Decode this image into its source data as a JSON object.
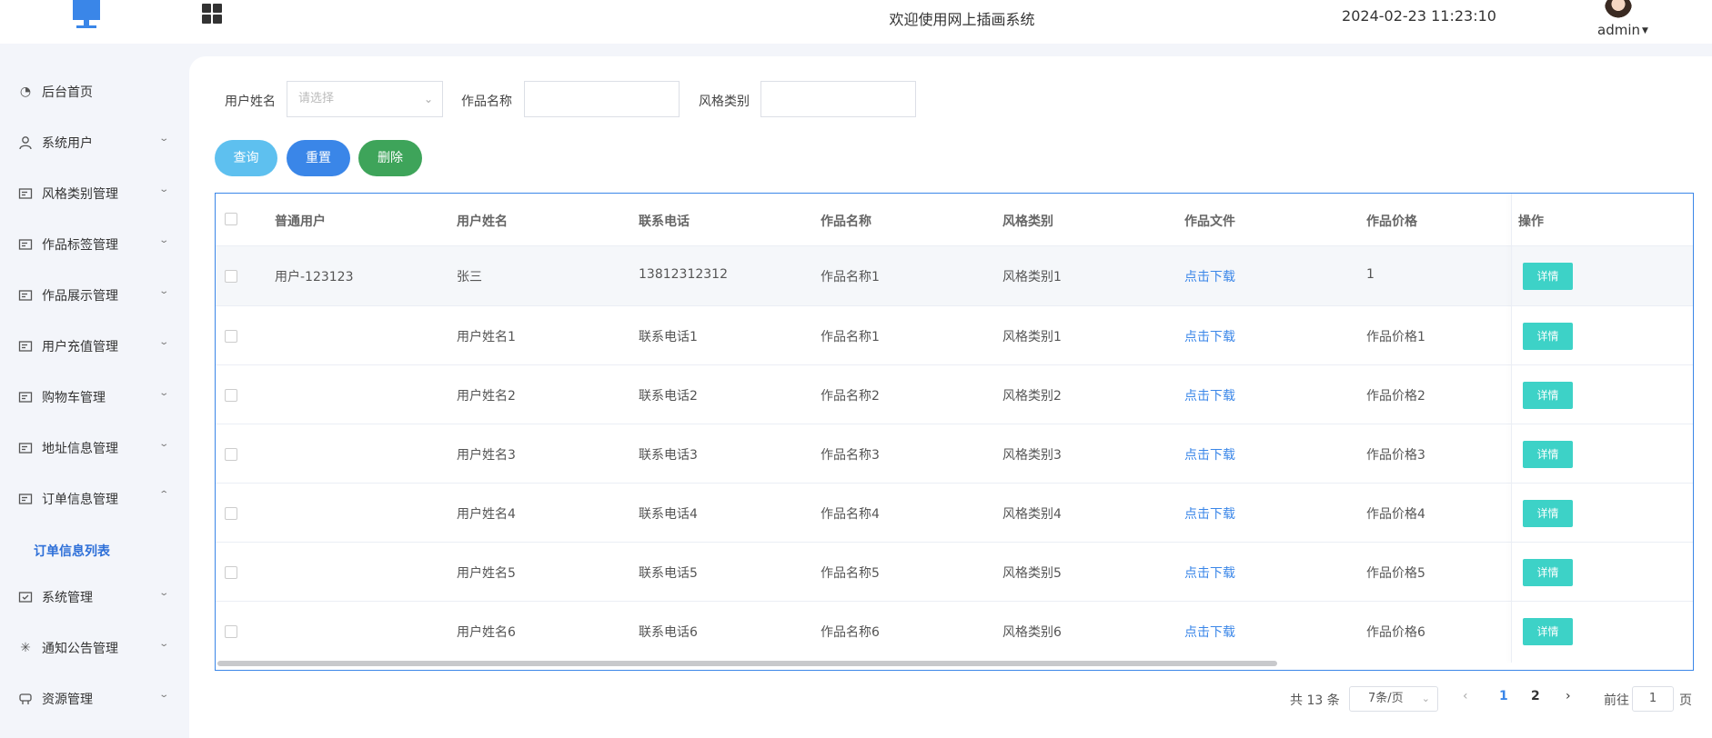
{
  "header": {
    "welcome": "欢迎使用网上插画系统",
    "datetime": "2024-02-23 11:23:10",
    "username": "admin"
  },
  "sidebar": {
    "items": [
      {
        "label": "后台首页",
        "icon": "dashboard-icon",
        "expanded": null
      },
      {
        "label": "系统用户",
        "icon": "user-icon",
        "expanded": false
      },
      {
        "label": "风格类别管理",
        "icon": "card-icon",
        "expanded": false
      },
      {
        "label": "作品标签管理",
        "icon": "card-icon",
        "expanded": false
      },
      {
        "label": "作品展示管理",
        "icon": "card-icon",
        "expanded": false
      },
      {
        "label": "用户充值管理",
        "icon": "card-icon",
        "expanded": false
      },
      {
        "label": "购物车管理",
        "icon": "card-icon",
        "expanded": false
      },
      {
        "label": "地址信息管理",
        "icon": "card-icon",
        "expanded": false
      },
      {
        "label": "订单信息管理",
        "icon": "card-icon",
        "expanded": true
      },
      {
        "label": "系统管理",
        "icon": "system-icon",
        "expanded": false
      },
      {
        "label": "通知公告管理",
        "icon": "notice-icon",
        "expanded": false
      },
      {
        "label": "资源管理",
        "icon": "resource-icon",
        "expanded": false
      }
    ],
    "active_sub": "订单信息列表"
  },
  "filters": {
    "user_name_label": "用户姓名",
    "user_name_placeholder": "请选择",
    "work_name_label": "作品名称",
    "work_name_value": "",
    "style_label": "风格类别",
    "style_value": ""
  },
  "buttons": {
    "query": "查询",
    "reset": "重置",
    "delete": "删除"
  },
  "table": {
    "columns": [
      "普通用户",
      "用户姓名",
      "联系电话",
      "作品名称",
      "风格类别",
      "作品文件",
      "作品价格",
      "操作"
    ],
    "download_label": "点击下载",
    "detail_label": "详情",
    "rows": [
      [
        "用户-123123",
        "张三",
        "13812312312",
        "作品名称1",
        "风格类别1",
        "1"
      ],
      [
        "",
        "用户姓名1",
        "联系电话1",
        "作品名称1",
        "风格类别1",
        "作品价格1"
      ],
      [
        "",
        "用户姓名2",
        "联系电话2",
        "作品名称2",
        "风格类别2",
        "作品价格2"
      ],
      [
        "",
        "用户姓名3",
        "联系电话3",
        "作品名称3",
        "风格类别3",
        "作品价格3"
      ],
      [
        "",
        "用户姓名4",
        "联系电话4",
        "作品名称4",
        "风格类别4",
        "作品价格4"
      ],
      [
        "",
        "用户姓名5",
        "联系电话5",
        "作品名称5",
        "风格类别5",
        "作品价格5"
      ],
      [
        "",
        "用户姓名6",
        "联系电话6",
        "作品名称6",
        "风格类别6",
        "作品价格6"
      ]
    ]
  },
  "pagination": {
    "total": "共 13 条",
    "page_size": "7条/页",
    "pages": [
      "1",
      "2"
    ],
    "current": "1",
    "goto_prefix": "前往",
    "goto_value": "1",
    "goto_suffix": "页"
  },
  "colors": {
    "accent": "#3a86e8",
    "query": "#5ec0ef",
    "delete": "#3ea45a",
    "detail": "#3dd2c7"
  }
}
